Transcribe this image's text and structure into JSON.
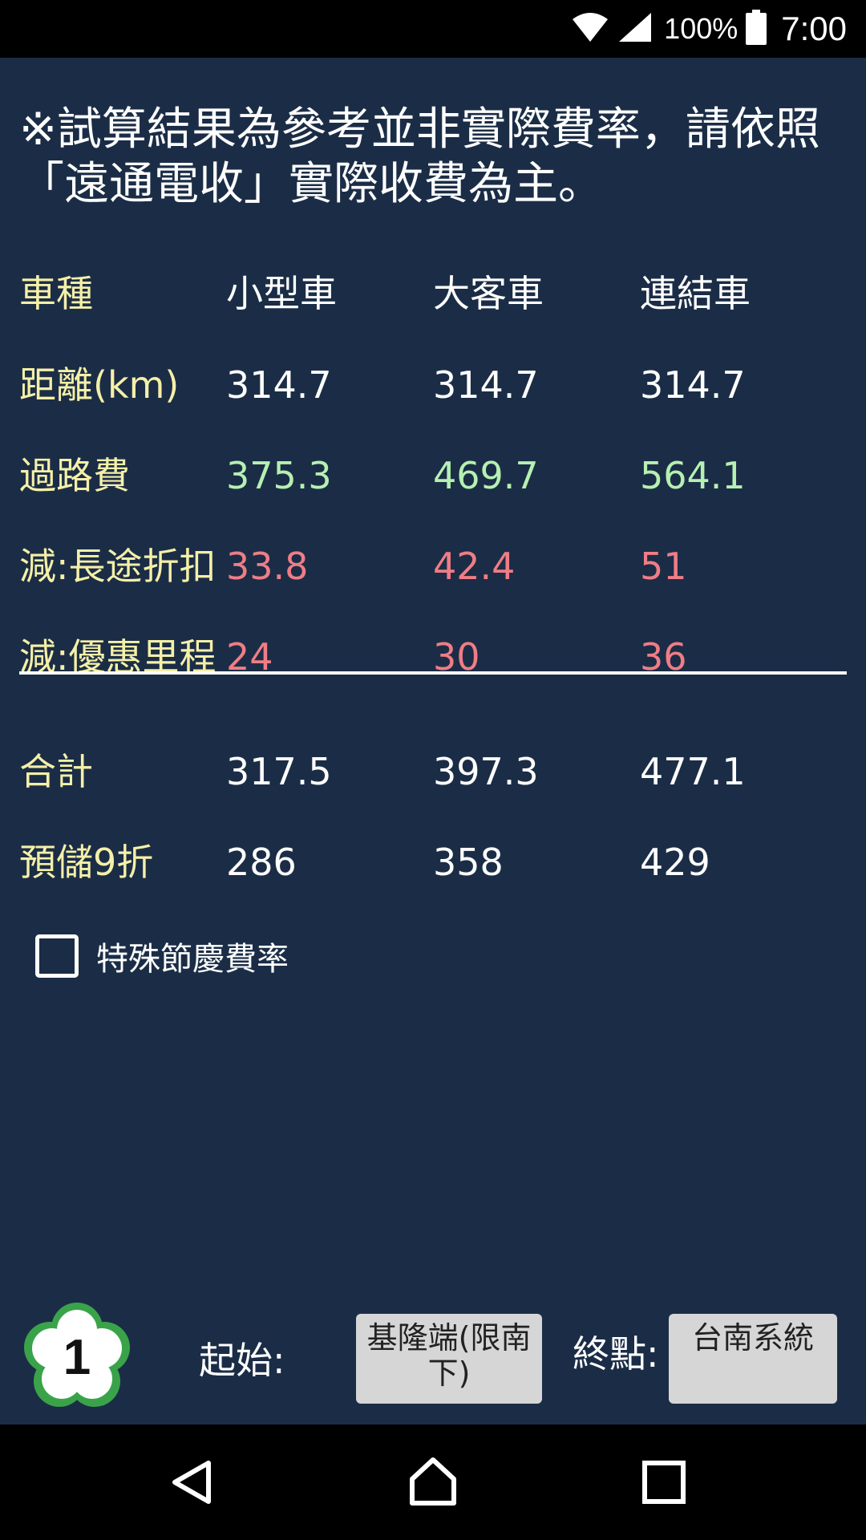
{
  "status_bar": {
    "battery_percent": "100%",
    "time": "7:00",
    "icons": [
      "wifi-icon",
      "cell-signal-icon",
      "battery-icon"
    ]
  },
  "notice": "※試算結果為參考並非實際費率，請依照「遠通電收」實際收費為主。",
  "table": {
    "header": {
      "label": "車種",
      "values": [
        "小型車",
        "大客車",
        "連結車"
      ]
    },
    "rows": [
      {
        "label": "距離(km)",
        "values": [
          "314.7",
          "314.7",
          "314.7"
        ],
        "tone": "white"
      },
      {
        "label": "過路費",
        "values": [
          "375.3",
          "469.7",
          "564.1"
        ],
        "tone": "green"
      },
      {
        "label": "減:長途折扣",
        "values": [
          "33.8",
          "42.4",
          "51"
        ],
        "tone": "red"
      },
      {
        "label": "減:優惠里程",
        "values": [
          "24",
          "30",
          "36"
        ],
        "tone": "red"
      }
    ],
    "totals": [
      {
        "label": "合計",
        "values": [
          "317.5",
          "397.3",
          "477.1"
        ]
      },
      {
        "label": "預儲9折",
        "values": [
          "286",
          "358",
          "429"
        ]
      }
    ]
  },
  "special_rate": {
    "label": "特殊節慶費率",
    "checked": false
  },
  "route": {
    "highway_number": "1",
    "start_label": "起始:",
    "start_value": "基隆端(限南下)",
    "end_label": "終點:",
    "end_value": "台南系統"
  },
  "colors": {
    "background": "#1b2d46",
    "label_yellow": "#f5f0a8",
    "positive_green": "#b6f0b2",
    "discount_red": "#f07d86",
    "logo_green": "#3aa34a"
  }
}
